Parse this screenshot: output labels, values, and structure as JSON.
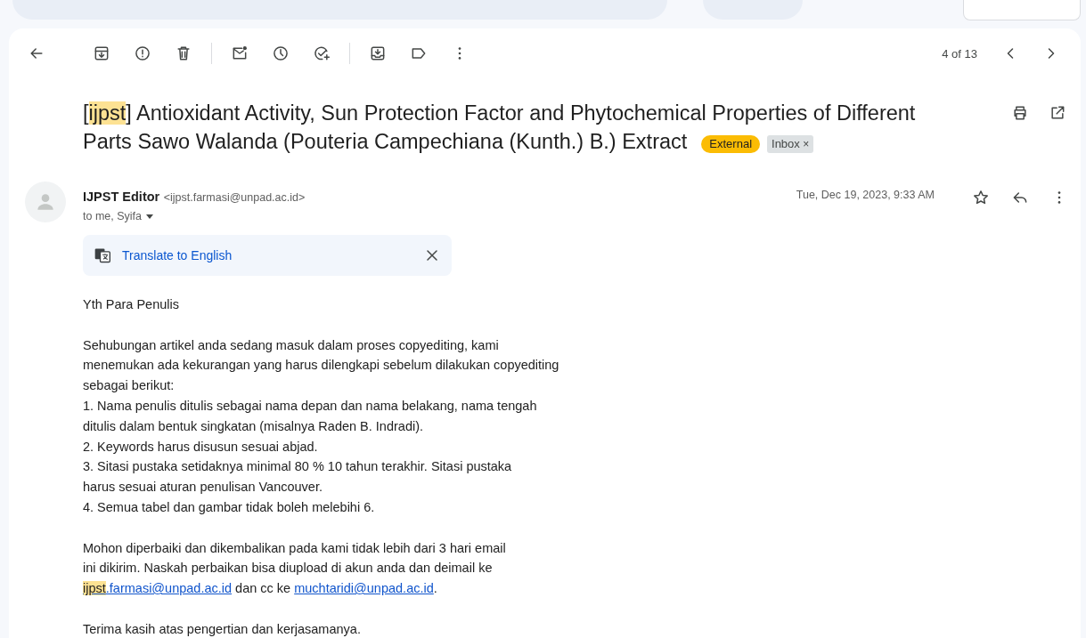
{
  "toolbar": {
    "buttons": [
      {
        "kind": "back"
      },
      {
        "kind": "archive"
      },
      {
        "kind": "spam"
      },
      {
        "kind": "delete"
      },
      {
        "kind": "sep"
      },
      {
        "kind": "unread"
      },
      {
        "kind": "snooze"
      },
      {
        "kind": "task"
      },
      {
        "kind": "sep"
      },
      {
        "kind": "move"
      },
      {
        "kind": "label"
      },
      {
        "kind": "more"
      }
    ],
    "counter": "4 of 13"
  },
  "subject": {
    "parts": [
      {
        "text": "[",
        "highlighted": false
      },
      {
        "text": "ijpst",
        "highlighted": true
      },
      {
        "text": "] Antioxidant Activity, Sun Protection Factor and Phytochemical Properties of Different Parts Sawo Walanda (Pouteria Campechiana (Kunth.) B.) Extract",
        "highlighted": false
      }
    ],
    "labels": [
      {
        "text": "External",
        "kind": "external"
      },
      {
        "text": "Inbox",
        "kind": "inbox",
        "remove": "×"
      }
    ]
  },
  "message": {
    "sender_name": "IJPST Editor",
    "sender_email": "<ijpst.farmasi@unpad.ac.id>",
    "recipients": "to me, Syifa",
    "date": "Tue, Dec 19, 2023, 9:33 AM",
    "translate": "Translate to English"
  },
  "body": [
    {
      "lines": [
        "Yth Para Penulis"
      ]
    },
    {
      "lines": [
        "Sehubungan artikel anda sedang masuk dalam proses copyediting, kami",
        "menemukan ada kekurangan yang harus dilengkapi sebelum dilakukan copyediting",
        "sebagai berikut:",
        "1. Nama penulis ditulis sebagai nama depan dan nama belakang, nama tengah",
        "ditulis dalam bentuk singkatan (misalnya Raden B. Indradi).",
        "2. Keywords harus disusun sesuai abjad.",
        "3. Sitasi pustaka setidaknya minimal 80 % 10 tahun terakhir. Sitasi pustaka",
        "harus sesuai aturan penulisan Vancouver.",
        "4. Semua tabel dan gambar tidak boleh melebihi 6."
      ]
    },
    {
      "lines": [
        "Mohon diperbaiki dan dikembalikan pada kami tidak lebih dari 3 hari email",
        "ini dikirim. Naskah perbaikan bisa diupload di akun anda dan deimail ke"
      ],
      "last_line": [
        {
          "kind": "link",
          "parts": [
            {
              "text": "ijpst",
              "highlighted": true
            },
            {
              "text": ".farmasi@unpad.ac.id",
              "highlighted": false
            }
          ]
        },
        {
          "kind": "text",
          "text": " dan cc ke "
        },
        {
          "kind": "link",
          "parts": [
            {
              "text": "muchtaridi@unpad.ac.id",
              "highlighted": false
            }
          ]
        },
        {
          "kind": "text",
          "text": "."
        }
      ]
    },
    {
      "lines": [
        "Terima kasih atas pengertian dan kerjasamanya."
      ]
    }
  ]
}
